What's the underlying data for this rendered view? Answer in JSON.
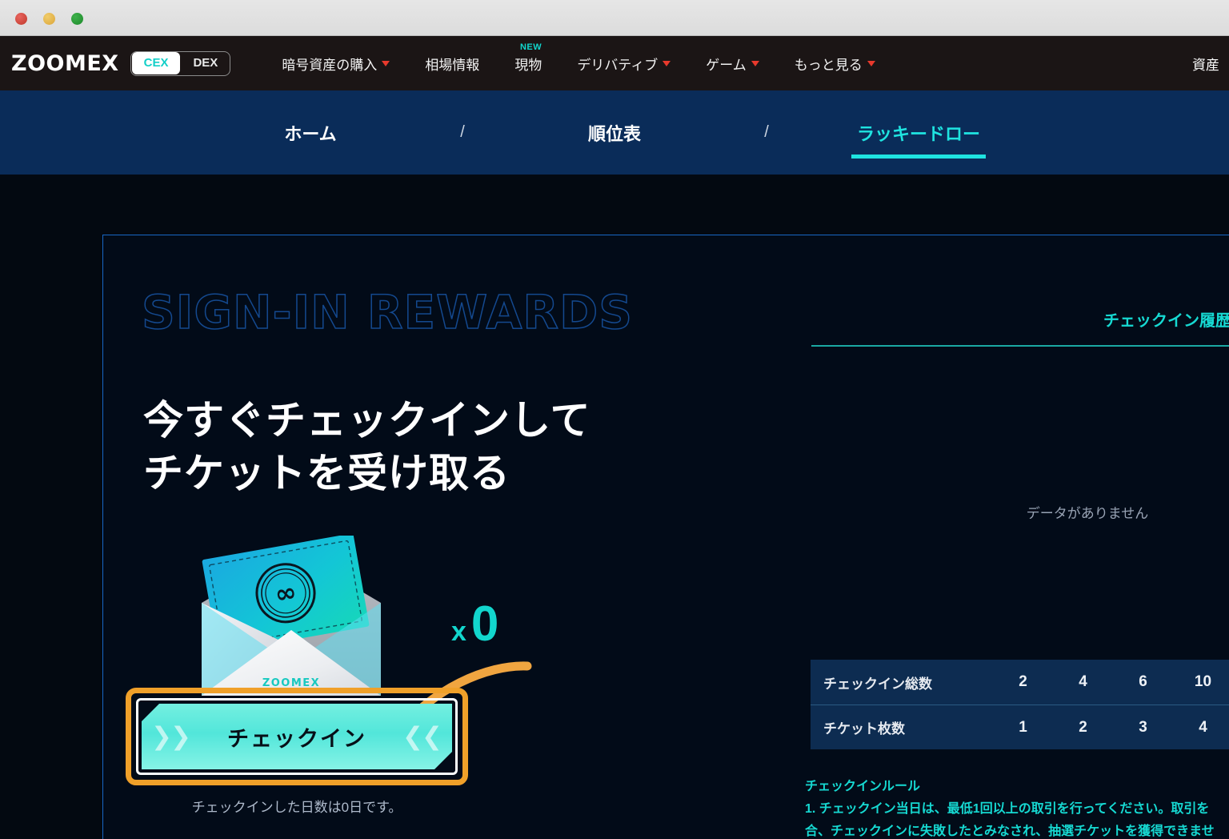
{
  "window": {
    "lights": [
      "close",
      "minimize",
      "zoom"
    ]
  },
  "header": {
    "logo": "ZOOMEX",
    "toggle": {
      "active": "CEX",
      "inactive": "DEX"
    },
    "nav": [
      {
        "label": "暗号資産の購入",
        "caret": true,
        "badge": ""
      },
      {
        "label": "相場情報",
        "caret": false,
        "badge": ""
      },
      {
        "label": "現物",
        "caret": false,
        "badge": "NEW"
      },
      {
        "label": "デリバティブ",
        "caret": true,
        "badge": ""
      },
      {
        "label": "ゲーム",
        "caret": true,
        "badge": ""
      },
      {
        "label": "もっと見る",
        "caret": true,
        "badge": ""
      }
    ],
    "right_label": "資産"
  },
  "subnav": {
    "items": [
      {
        "label": "ホーム",
        "active": false
      },
      {
        "label": "順位表",
        "active": false
      },
      {
        "label": "ラッキードロー",
        "active": true
      }
    ],
    "separator": "/"
  },
  "hero": {
    "ghost_title": "SIGN-IN REWARDS",
    "title_line1": "今すぐチェックインして",
    "title_line2": "チケットを受け取る",
    "ticket_brand": "ZOOMEX",
    "counter_x": "x",
    "counter_value": "0",
    "checkin_button": "チェックイン",
    "checkin_caption": "チェックインした日数は0日です。"
  },
  "history": {
    "title": "チェックイン履歴",
    "empty_text": "データがありません"
  },
  "reward_table": {
    "rows": [
      {
        "label": "チェックイン総数",
        "values": [
          "2",
          "4",
          "6",
          "10"
        ]
      },
      {
        "label": "チケット枚数",
        "values": [
          "1",
          "2",
          "3",
          "4"
        ]
      }
    ]
  },
  "rules": {
    "title": "チェックインルール",
    "line1": "1. チェックイン当日は、最低1回以上の取引を行ってください。取引を",
    "line2": "合、チェックインに失敗したとみなされ、抽選チケットを獲得できませ"
  },
  "colors": {
    "accent_cyan": "#12d6cd",
    "nav_bg": "#1b1515",
    "subnav_bg": "#0a2c59",
    "page_bg": "#030911",
    "card_border": "#1766c4",
    "table_bg": "#0d2c51",
    "highlight_orange": "#f0a029",
    "badge_red": "#e8392c"
  }
}
